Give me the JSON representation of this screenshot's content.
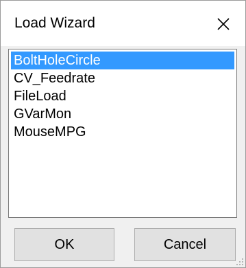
{
  "window": {
    "title": "Load Wizard",
    "close_icon": "close-icon"
  },
  "list": {
    "items": [
      {
        "label": "BoltHoleCircle",
        "selected": true
      },
      {
        "label": "CV_Feedrate",
        "selected": false
      },
      {
        "label": "FileLoad",
        "selected": false
      },
      {
        "label": "GVarMon",
        "selected": false
      },
      {
        "label": "MouseMPG",
        "selected": false
      }
    ]
  },
  "buttons": {
    "ok_label": "OK",
    "cancel_label": "Cancel"
  },
  "colors": {
    "selection": "#3399ff",
    "dialog_background": "#f0f0f0",
    "titlebar_background": "#ffffff",
    "button_face": "#e1e1e1"
  }
}
